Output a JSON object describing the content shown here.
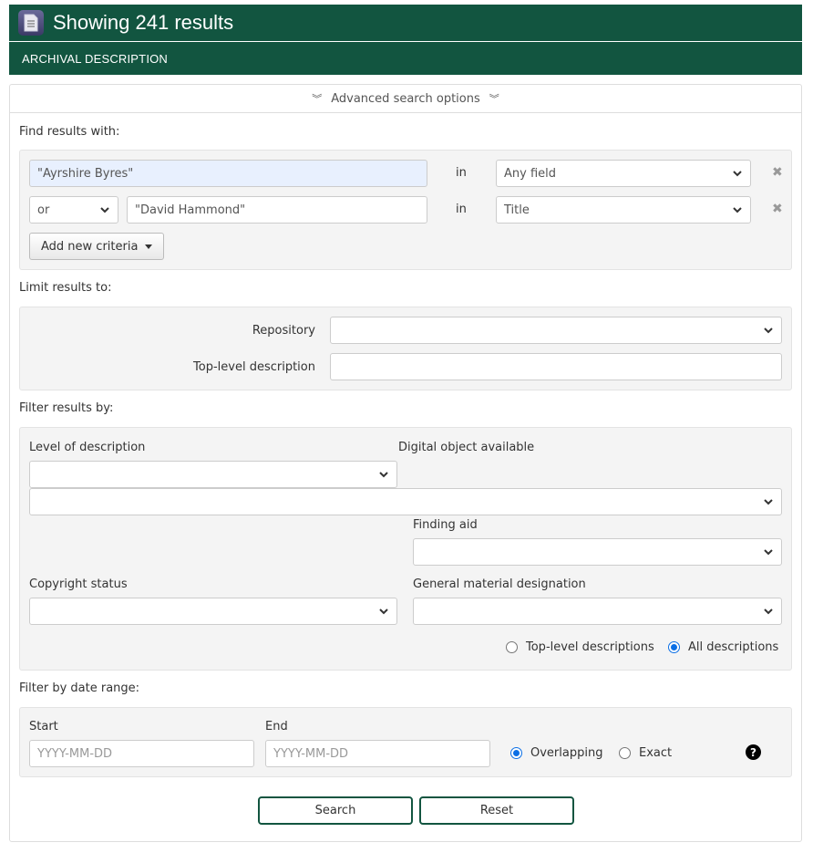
{
  "header": {
    "title": "Showing 241 results",
    "icon": "document-icon",
    "subtitle": "ARCHIVAL DESCRIPTION"
  },
  "advanced_toggle": {
    "label": "Advanced search options",
    "icon": "double-chevron-down-icon"
  },
  "find": {
    "label": "Find results with:",
    "rows": [
      {
        "operator": null,
        "query": "\"Ayrshire Byres\"",
        "in_label": "in",
        "field": "Any field"
      },
      {
        "operator": "or",
        "query": "\"David Hammond\"",
        "in_label": "in",
        "field": "Title"
      }
    ],
    "remove_icon": "close-icon",
    "add_button_label": "Add new criteria"
  },
  "limit": {
    "label": "Limit results to:",
    "repository_label": "Repository",
    "repository_value": "",
    "top_level_label": "Top-level description",
    "top_level_value": ""
  },
  "filter": {
    "label": "Filter results by:",
    "level_label": "Level of description",
    "level_value": "",
    "digital_object_label": "Digital object available",
    "digital_object_value": "",
    "finding_aid_label": "Finding aid",
    "finding_aid_value": "",
    "copyright_label": "Copyright status",
    "copyright_value": "",
    "gmd_label": "General material designation",
    "gmd_value": "",
    "scope_options": [
      {
        "label": "Top-level descriptions",
        "checked": false
      },
      {
        "label": "All descriptions",
        "checked": true
      }
    ]
  },
  "date_range": {
    "label": "Filter by date range:",
    "start_label": "Start",
    "start_placeholder": "YYYY-MM-DD",
    "end_label": "End",
    "end_placeholder": "YYYY-MM-DD",
    "type_options": [
      {
        "label": "Overlapping",
        "checked": true
      },
      {
        "label": "Exact",
        "checked": false
      }
    ],
    "help_icon": "question-circle-icon"
  },
  "actions": {
    "search_label": "Search",
    "reset_label": "Reset"
  },
  "colors": {
    "brand": "#125540",
    "radio_checked": "#0b6fe5",
    "autofill_bg": "#e8f0fe"
  }
}
